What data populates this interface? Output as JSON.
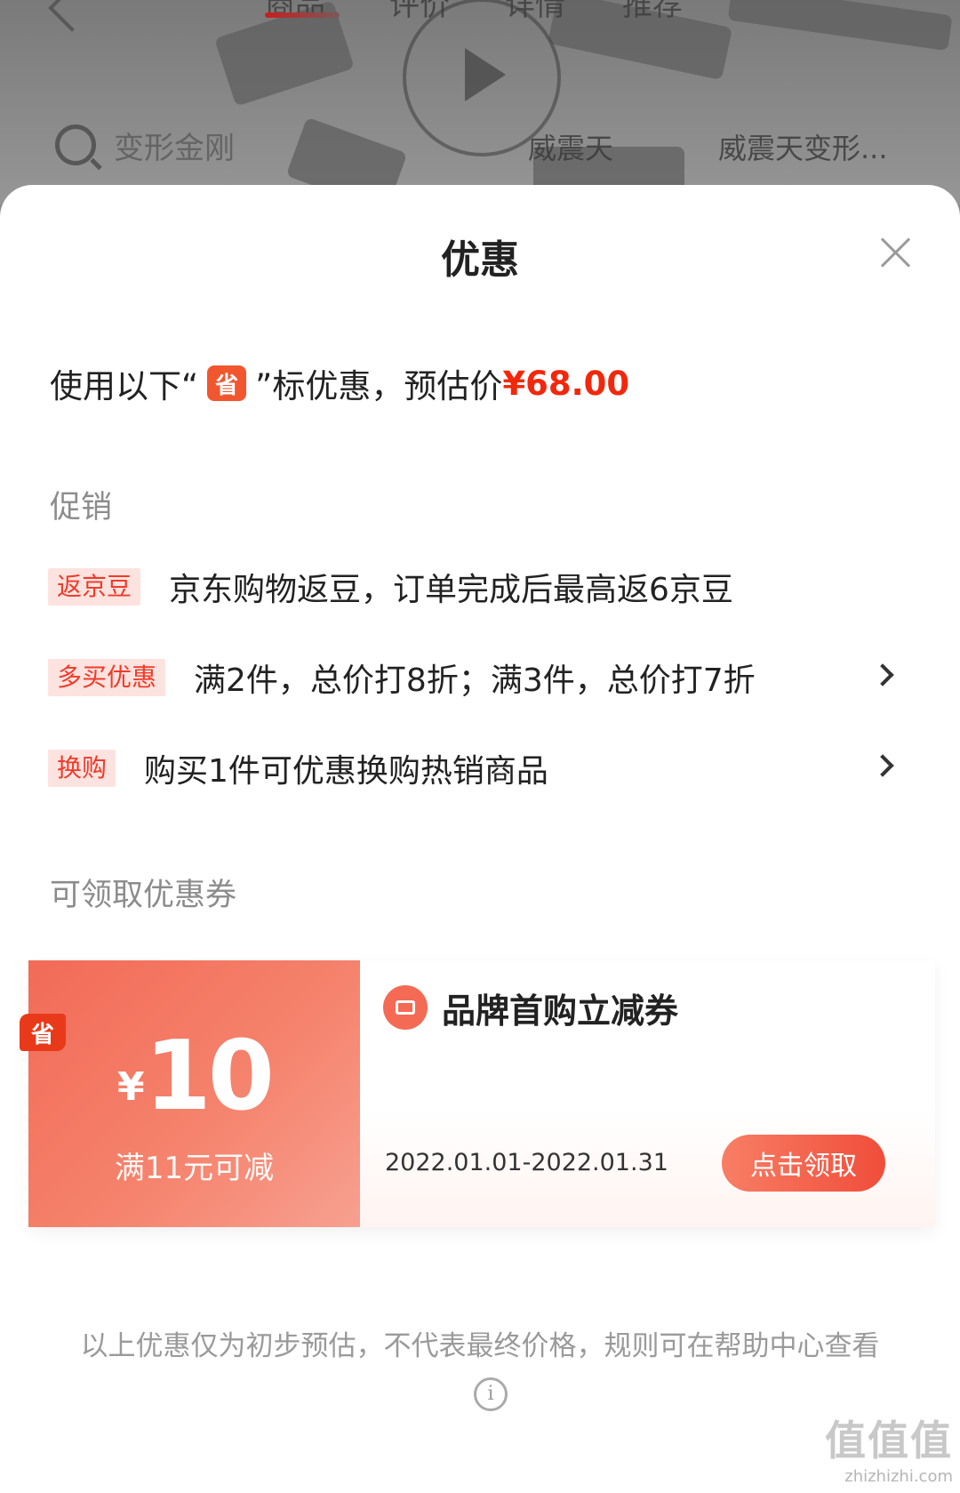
{
  "background_page": {
    "tabs": [
      "商品",
      "评价",
      "详情",
      "推荐"
    ],
    "search_placeholder": "变形金刚",
    "links": [
      "威震天",
      "威震天变形..."
    ]
  },
  "sheet": {
    "title": "优惠",
    "estimate": {
      "prefix": "使用以下“",
      "badge": "省",
      "suffix": "”标优惠，预估价",
      "price": "¥68.00"
    },
    "promo_section_label": "促销",
    "promotions": [
      {
        "tag": "返京豆",
        "text": "京东购物返豆，订单完成后最高返6京豆",
        "has_arrow": false
      },
      {
        "tag": "多买优惠",
        "text": "满2件，总价打8折；满3件，总价打7折",
        "has_arrow": true
      },
      {
        "tag": "换购",
        "text": "购买1件可优惠换购热销商品",
        "has_arrow": true
      }
    ],
    "coupon_section_label": "可领取优惠券",
    "coupon": {
      "badge": "省",
      "currency": "¥",
      "amount": "10",
      "condition": "满11元可减",
      "name": "品牌首购立减券",
      "date_range": "2022.01.01-2022.01.31",
      "claim_label": "点击领取"
    },
    "disclaimer": "以上优惠仅为初步预估，不代表最终价格，规则可在帮助中心查看",
    "info_glyph": "i"
  },
  "watermark": {
    "glyphs": "值值值",
    "text": "zhizhizhi.com"
  },
  "colors": {
    "accent_red": "#f2270c",
    "tag_bg": "#fde3df",
    "coupon_left": "#f26b57"
  }
}
